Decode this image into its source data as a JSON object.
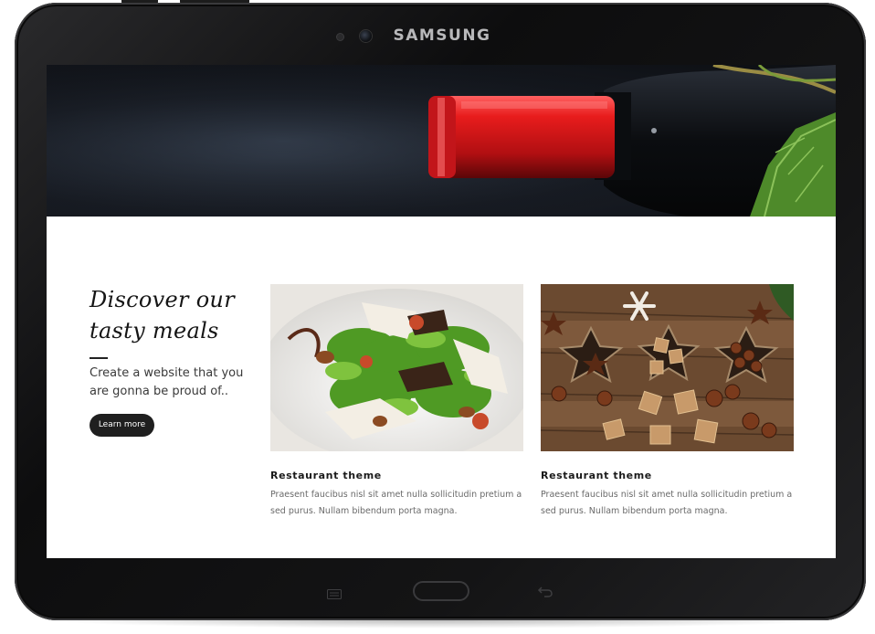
{
  "device": {
    "brand": "SAMSUNG"
  },
  "intro": {
    "title_line1": "Discover our",
    "title_line2": "tasty meals",
    "text": "Create a website that you are gonna be proud of..",
    "button_label": "Learn more"
  },
  "cards": [
    {
      "title": "Restaurant theme",
      "text": "Praesent faucibus nisl sit amet nulla sollicitudin pretium a sed purus. Nullam bibendum porta magna."
    },
    {
      "title": "Restaurant theme",
      "text": "Praesent faucibus nisl sit amet nulla sollicitudin pretium a sed purus. Nullam bibendum porta magna."
    }
  ],
  "icons": {
    "menu": "menu-icon",
    "back": "back-arrow-icon"
  },
  "colors": {
    "button_bg": "#1f1f1f",
    "wine_cap": "#d4181a",
    "tablet_body": "#111112"
  }
}
